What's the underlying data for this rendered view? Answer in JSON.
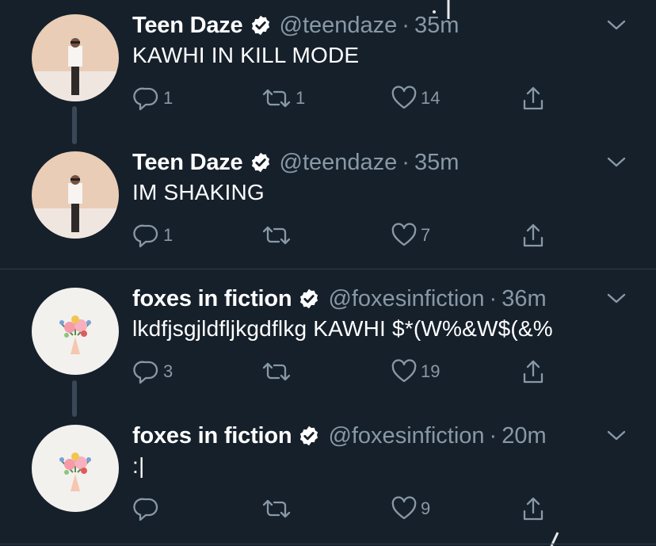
{
  "tweets": [
    {
      "name": "Teen Daze",
      "handle": "@teendaze",
      "time": "35m",
      "text": "KAWHI IN KILL MODE",
      "replies": "1",
      "retweets": "1",
      "likes": "14"
    },
    {
      "name": "Teen Daze",
      "handle": "@teendaze",
      "time": "35m",
      "text": "IM SHAKING",
      "replies": "1",
      "retweets": "",
      "likes": "7"
    },
    {
      "name": "foxes in fiction",
      "handle": "@foxesinfiction",
      "time": "36m",
      "text": "lkdfjsgjldfljkgdflkg KAWHI $*(W%&W$(&%",
      "replies": "3",
      "retweets": "",
      "likes": "19"
    },
    {
      "name": "foxes in fiction",
      "handle": "@foxesinfiction",
      "time": "20m",
      "text": ":|",
      "replies": "",
      "retweets": "",
      "likes": "9"
    }
  ],
  "separator": "·",
  "colors": {
    "background": "#16202b",
    "text_primary": "#ffffff",
    "text_secondary": "#8899a6",
    "thread_line": "#3a4757",
    "divider": "#2f3b48"
  },
  "icons": [
    "verified-badge-icon",
    "chevron-down-icon",
    "reply-icon",
    "retweet-icon",
    "like-icon",
    "share-icon"
  ]
}
